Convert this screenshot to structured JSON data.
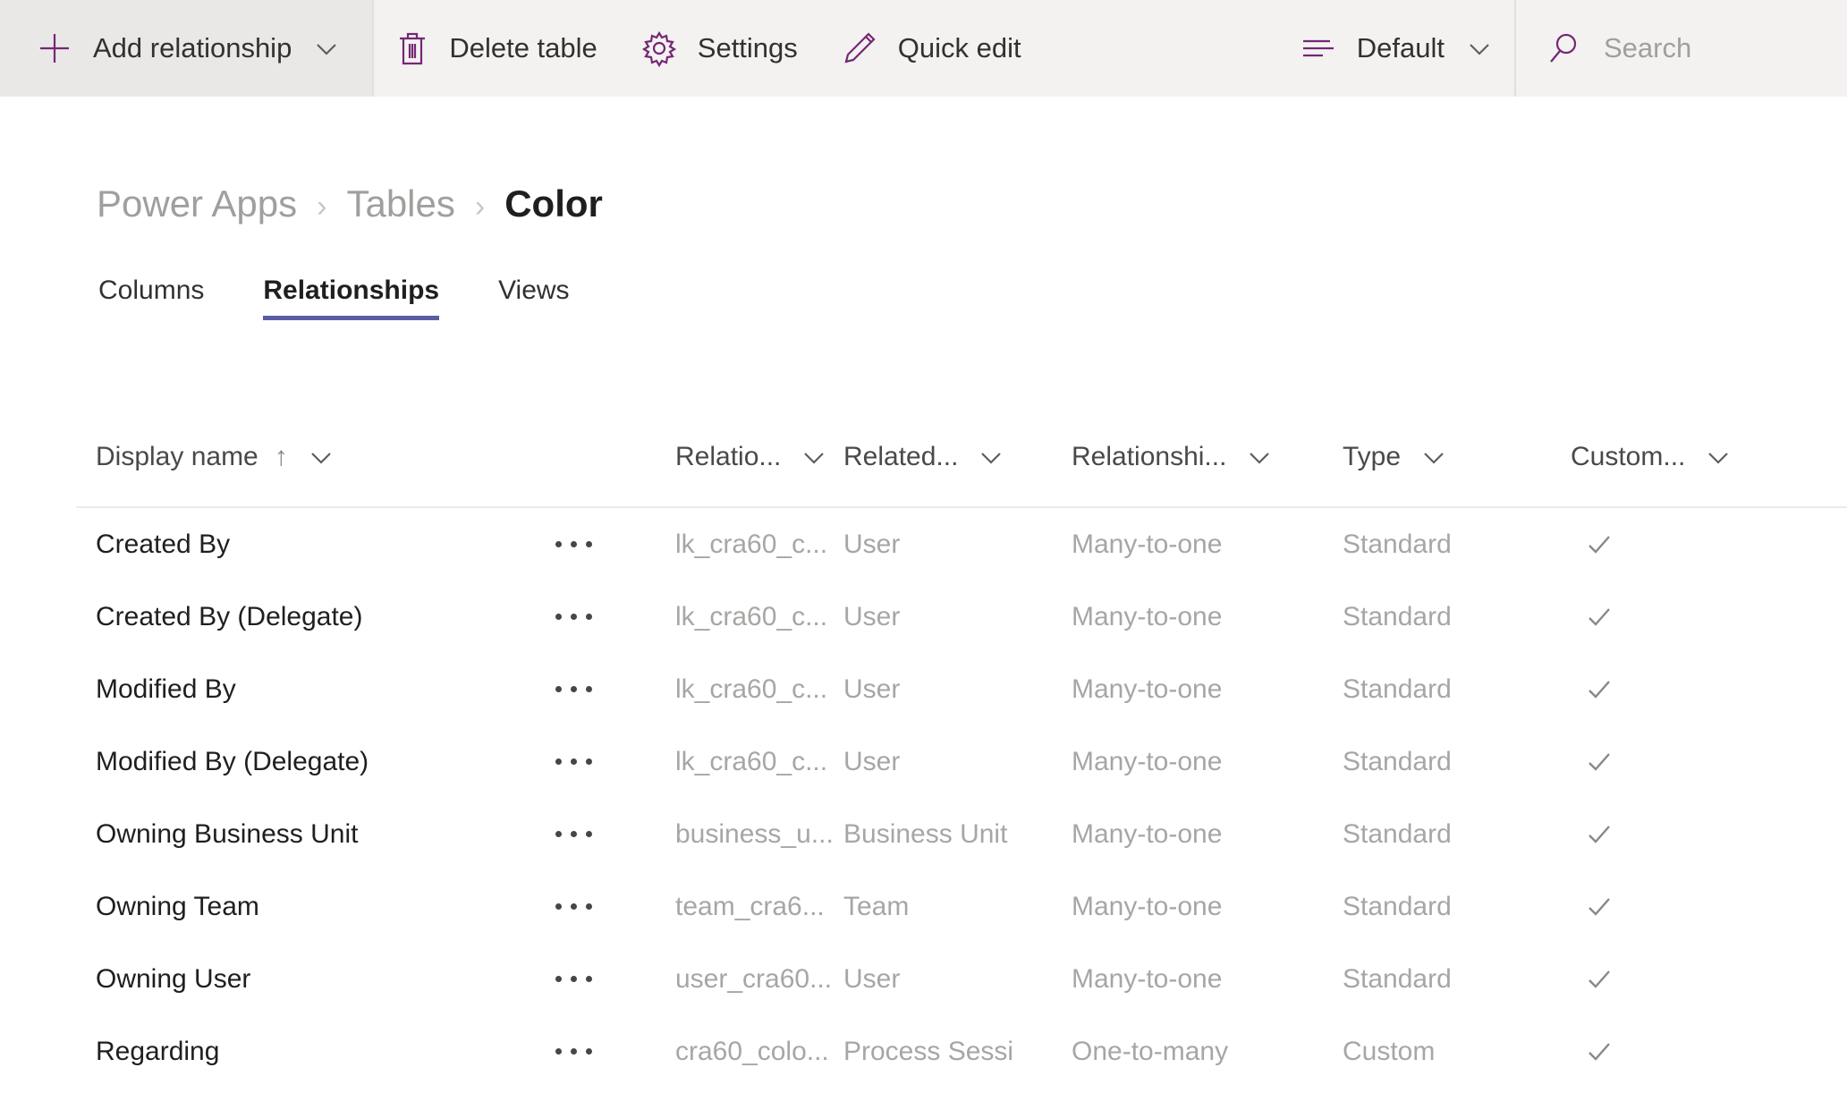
{
  "toolbar": {
    "add_relationship": {
      "label": "Add relationship",
      "icon": "plus-icon",
      "chevron": "chevron-down-icon"
    },
    "delete_table": {
      "label": "Delete table",
      "icon": "trash-icon"
    },
    "settings": {
      "label": "Settings",
      "icon": "gear-icon"
    },
    "quick_edit": {
      "label": "Quick edit",
      "icon": "pencil-icon"
    },
    "view_selector": {
      "label": "Default",
      "icon": "view-list-icon",
      "chevron": "chevron-down-icon"
    },
    "search": {
      "placeholder": "Search",
      "icon": "search-icon",
      "value": ""
    }
  },
  "breadcrumb": {
    "items": [
      {
        "label": "Power Apps",
        "current": false
      },
      {
        "label": "Tables",
        "current": false
      },
      {
        "label": "Color",
        "current": true
      }
    ],
    "separator": "›"
  },
  "tabs": [
    {
      "label": "Columns",
      "active": false
    },
    {
      "label": "Relationships",
      "active": true
    },
    {
      "label": "Views",
      "active": false
    }
  ],
  "grid": {
    "sort": {
      "column": "Display name",
      "direction": "ascending",
      "glyph": "↑"
    },
    "columns": [
      {
        "label": "Display name",
        "sorted": true
      },
      {
        "label": "Relatio...",
        "sorted": false
      },
      {
        "label": "Related...",
        "sorted": false
      },
      {
        "label": "Relationshi...",
        "sorted": false
      },
      {
        "label": "Type",
        "sorted": false
      },
      {
        "label": "Custom...",
        "sorted": false
      }
    ],
    "rows": [
      {
        "display_name": "Created By",
        "relationship_name": "lk_cra60_c...",
        "related_table": "User",
        "relationship_type": "Many-to-one",
        "type": "Standard",
        "customizable": true
      },
      {
        "display_name": "Created By (Delegate)",
        "relationship_name": "lk_cra60_c...",
        "related_table": "User",
        "relationship_type": "Many-to-one",
        "type": "Standard",
        "customizable": true
      },
      {
        "display_name": "Modified By",
        "relationship_name": "lk_cra60_c...",
        "related_table": "User",
        "relationship_type": "Many-to-one",
        "type": "Standard",
        "customizable": true
      },
      {
        "display_name": "Modified By (Delegate)",
        "relationship_name": "lk_cra60_c...",
        "related_table": "User",
        "relationship_type": "Many-to-one",
        "type": "Standard",
        "customizable": true
      },
      {
        "display_name": "Owning Business Unit",
        "relationship_name": "business_u...",
        "related_table": "Business Unit",
        "relationship_type": "Many-to-one",
        "type": "Standard",
        "customizable": true
      },
      {
        "display_name": "Owning Team",
        "relationship_name": "team_cra6...",
        "related_table": "Team",
        "relationship_type": "Many-to-one",
        "type": "Standard",
        "customizable": true
      },
      {
        "display_name": "Owning User",
        "relationship_name": "user_cra60...",
        "related_table": "User",
        "relationship_type": "Many-to-one",
        "type": "Standard",
        "customizable": true
      },
      {
        "display_name": "Regarding",
        "relationship_name": "cra60_colo...",
        "related_table": "Process Sessi",
        "relationship_type": "One-to-many",
        "type": "Custom",
        "customizable": true
      }
    ],
    "row_menu_glyph": "ellipsis-icon",
    "check_glyph": "check-icon"
  },
  "colors": {
    "accent_purple": "#742774",
    "tab_underline": "#5c5ca5",
    "commandbar_bg": "#f3f2f1",
    "highlight_bg": "#e9e8e7",
    "muted_text": "#a8a6a4",
    "primary_text": "#201f1e"
  }
}
